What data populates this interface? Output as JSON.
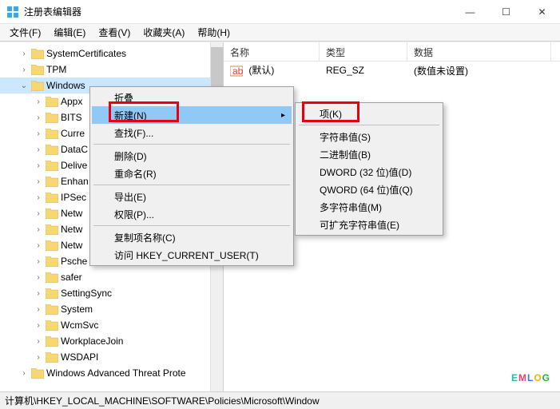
{
  "window": {
    "title": "注册表编辑器",
    "controls": {
      "min": "—",
      "max": "☐",
      "close": "✕"
    }
  },
  "menubar": {
    "file": "文件(F)",
    "edit": "编辑(E)",
    "view": "查看(V)",
    "favorites": "收藏夹(A)",
    "help": "帮助(H)"
  },
  "tree": {
    "items": [
      {
        "indent": 1,
        "tw": "›",
        "label": "SystemCertificates"
      },
      {
        "indent": 1,
        "tw": "›",
        "label": "TPM"
      },
      {
        "indent": 1,
        "tw": "⌄",
        "label": "Windows",
        "selected": true
      },
      {
        "indent": 2,
        "tw": "›",
        "label": "Appx"
      },
      {
        "indent": 2,
        "tw": "›",
        "label": "BITS"
      },
      {
        "indent": 2,
        "tw": "›",
        "label": "Curre"
      },
      {
        "indent": 2,
        "tw": "›",
        "label": "DataC"
      },
      {
        "indent": 2,
        "tw": "›",
        "label": "Delive"
      },
      {
        "indent": 2,
        "tw": "›",
        "label": "Enhan"
      },
      {
        "indent": 2,
        "tw": "›",
        "label": "IPSec"
      },
      {
        "indent": 2,
        "tw": "›",
        "label": "Netw"
      },
      {
        "indent": 2,
        "tw": "›",
        "label": "Netw"
      },
      {
        "indent": 2,
        "tw": "›",
        "label": "Netw"
      },
      {
        "indent": 2,
        "tw": "›",
        "label": "Psche"
      },
      {
        "indent": 2,
        "tw": "›",
        "label": "safer"
      },
      {
        "indent": 2,
        "tw": "›",
        "label": "SettingSync"
      },
      {
        "indent": 2,
        "tw": "›",
        "label": "System"
      },
      {
        "indent": 2,
        "tw": "›",
        "label": "WcmSvc"
      },
      {
        "indent": 2,
        "tw": "›",
        "label": "WorkplaceJoin"
      },
      {
        "indent": 2,
        "tw": "›",
        "label": "WSDAPI"
      },
      {
        "indent": 1,
        "tw": "›",
        "label": "Windows Advanced Threat Prote"
      }
    ]
  },
  "list": {
    "headers": {
      "name": "名称",
      "type": "类型",
      "data": "数据"
    },
    "row": {
      "name": "(默认)",
      "type": "REG_SZ",
      "data": "(数值未设置)"
    },
    "col_widths": {
      "name": 120,
      "type": 110,
      "data": 180
    }
  },
  "context_menu_1": {
    "collapse": "折叠",
    "new": "新建(N)",
    "find": "查找(F)...",
    "delete": "删除(D)",
    "rename": "重命名(R)",
    "export": "导出(E)",
    "perm": "权限(P)...",
    "copykey": "复制项名称(C)",
    "goto": "访问 HKEY_CURRENT_USER(T)"
  },
  "context_menu_2": {
    "key": "项(K)",
    "string": "字符串值(S)",
    "binary": "二进制值(B)",
    "dword": "DWORD (32 位)值(D)",
    "qword": "QWORD (64 位)值(Q)",
    "multistring": "多字符串值(M)",
    "expandstring": "可扩充字符串值(E)"
  },
  "statusbar": {
    "path": "计算机\\HKEY_LOCAL_MACHINE\\SOFTWARE\\Policies\\Microsoft\\Window"
  },
  "watermark": {
    "c1": "E",
    "c2": "M",
    "c3": "L",
    "c4": "O",
    "c5": "G"
  }
}
